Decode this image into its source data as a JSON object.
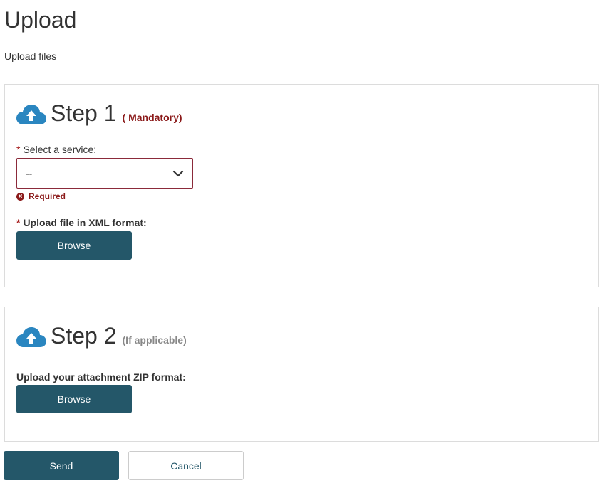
{
  "page": {
    "title": "Upload",
    "subtitle": "Upload files"
  },
  "step1": {
    "icon": "cloud-upload-icon",
    "title": "Step 1",
    "note": "( Mandatory)",
    "service_label": "Select a service:",
    "service_required_marker": "*",
    "service_value": "--",
    "service_error": "Required",
    "xml_label": "Upload file in XML format:",
    "xml_required_marker": "*",
    "browse_label": "Browse"
  },
  "step2": {
    "icon": "cloud-upload-icon",
    "title": "Step 2",
    "note": "(If applicable)",
    "zip_label": "Upload your attachment ZIP format:",
    "browse_label": "Browse"
  },
  "actions": {
    "send_label": "Send",
    "cancel_label": "Cancel"
  },
  "colors": {
    "primary": "#245769",
    "icon": "#2a86c0",
    "error": "#8b1a1a"
  }
}
